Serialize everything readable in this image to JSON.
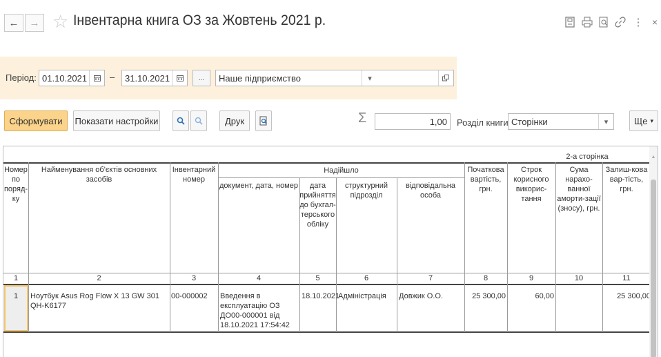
{
  "window": {
    "title": "Інвентарна книга ОЗ за Жовтень 2021 р.",
    "close_glyph": "×",
    "more_glyph": "⋮"
  },
  "filters": {
    "period_label": "Період:",
    "date_from": "01.10.2021",
    "dash": "–",
    "date_to": "31.10.2021",
    "ellipsis": "...",
    "organization": "Наше підприємство"
  },
  "toolbar": {
    "generate": "Сформувати",
    "show_settings": "Показати настройки",
    "print": "Друк",
    "sigma": "Σ",
    "sum_value": "1,00",
    "section_label": "Розділ книги:",
    "section_value": "Сторінки",
    "more": "Ще"
  },
  "report": {
    "page_label": "2-а сторінка",
    "headers": {
      "col1": "Номер по поряд-ку",
      "col2": "Найменування об'єктів основних засобів",
      "col3": "Інвентарний номер",
      "group": "Надійшло",
      "col4": "документ, дата, номер",
      "col5": "дата прийняття до бухгал-терського обліку",
      "col6": "структурний підрозділ",
      "col7": "відповідальна особа",
      "col8": "Початкова вартість, грн.",
      "col9": "Строк корисного викорис-тання",
      "col10": "Сума нарахо-ванної аморти-зації (зносу), грн.",
      "col11": "Залиш-кова вар-тість, грн."
    },
    "col_numbers": [
      "1",
      "2",
      "3",
      "4",
      "5",
      "6",
      "7",
      "8",
      "9",
      "10",
      "11"
    ],
    "rows": [
      {
        "num": "1",
        "name": "Ноутбук Asus Rog Flow X 13 GW 301 QH-K6177",
        "inv": "00-000002",
        "doc": "Введення в експлуатацію ОЗ ДО00-000001 від 18.10.2021 17:54:42",
        "date": "18.10.2021",
        "dept": "Адміністрація",
        "person": "Довжик О.О.",
        "initial_cost": "25 300,00",
        "useful_life": "60,00",
        "depreciation": "",
        "residual": "25 300,00"
      }
    ]
  }
}
